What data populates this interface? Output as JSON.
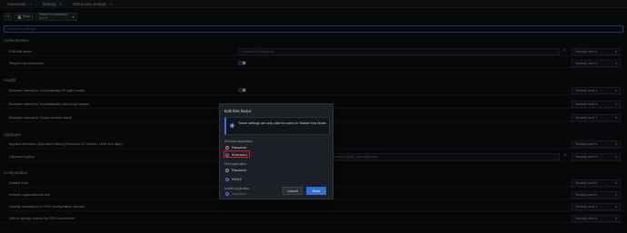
{
  "tabs": [
    {
      "label": "Passwords",
      "active": false
    },
    {
      "label": "Settings",
      "active": true
    },
    {
      "label": "Global user settings",
      "active": false
    }
  ],
  "toolbar": {
    "save_label": "Save",
    "restore_select": "Rétablir les paramètres par défaut",
    "restore_select_short": "Reset to standard / 6.2.0"
  },
  "search": {
    "placeholder": "Search in settings"
  },
  "sections": {
    "authentication": "Authentication",
    "autofill": "Autofill",
    "clipboard": "Clipboard",
    "configuration": "Configuration"
  },
  "rows": {
    "edit_first_factor": "Edit first factor",
    "edit_first_factor_value": "Password & Password",
    "require_second_factor": "Require second factor",
    "autofill_1": "Browser extension: Automatically fill login masks",
    "autofill_2": "Browser extension: Automatically send login masks",
    "autofill_3": "Browser extension: Exact domain check",
    "clipboard_1": "Bypass Windows Clipboard history (Windows 10 Version 1809 and later)",
    "clipboard_2": "Clipboard policy",
    "clipboard_2_value": "Default (Cliplib), User Clipboard",
    "config_1": "Default form",
    "config_2": "Default organisational unit",
    "config_3": "Display animations in SSO configuration window",
    "config_4": "Has to specify reason for RDP connection"
  },
  "levels": {
    "l5": "Security level 5",
    "l1": "Security level 1",
    "l0": "Security level 0"
  },
  "modal": {
    "title": "Edit first factor",
    "info": "These settings are only valid for users in 'Master Key Mode.",
    "windows_group": "Windows application",
    "windows_opt1": "Password",
    "windows_opt2": "Smartcard",
    "web_group": "Web application",
    "web_opt1": "Password",
    "web_opt2": "FIDO2",
    "mobile_group": "Mobile Application",
    "mobile_opt1": "Password",
    "cancel": "Cancel",
    "save": "Save"
  },
  "colors": {
    "accent": "#3d6fd6",
    "highlight": "#e0141e"
  }
}
